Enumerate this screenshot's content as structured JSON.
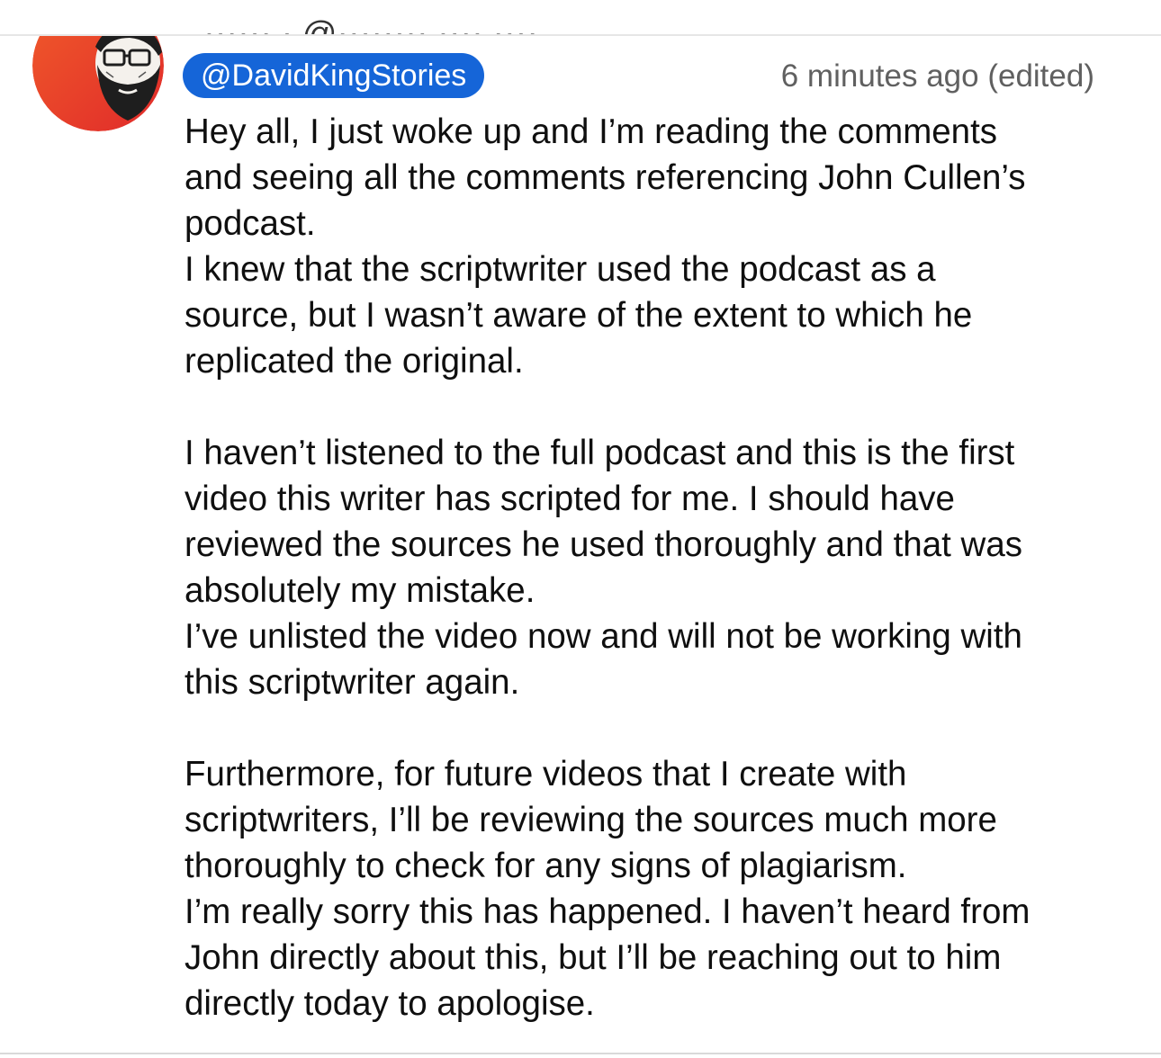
{
  "comment": {
    "author_handle": "@DavidKingStories",
    "timestamp": "6 minutes ago (edited)",
    "lines": [
      "Hey all, I just woke up and I’m reading the comments",
      "and seeing all the comments referencing John Cullen’s",
      "podcast.",
      "I knew that the scriptwriter used the podcast as a",
      "source, but I wasn’t aware of the extent to which he",
      "replicated the original.",
      "",
      "I haven’t listened to the full podcast and this is the first",
      "video this writer has scripted for me. I should have",
      "reviewed the sources he used thoroughly and that was",
      "absolutely my mistake.",
      "I’ve unlisted the video now and will not be working with",
      "this scriptwriter again.",
      "",
      "Furthermore, for future videos that I create with",
      "scriptwriters, I’ll be reviewing the sources much more",
      "thoroughly to check for any signs of plagiarism.",
      "I’m really sorry this has happened. I haven’t heard from",
      "John directly about this, but I’ll be reaching out to him",
      "directly today to apologise."
    ]
  },
  "colors": {
    "handle_chip": "#1565d8",
    "avatar_bg": "#e8412a",
    "timestamp": "#606060"
  },
  "icons": {
    "avatar": "bearded-man-portrait"
  }
}
